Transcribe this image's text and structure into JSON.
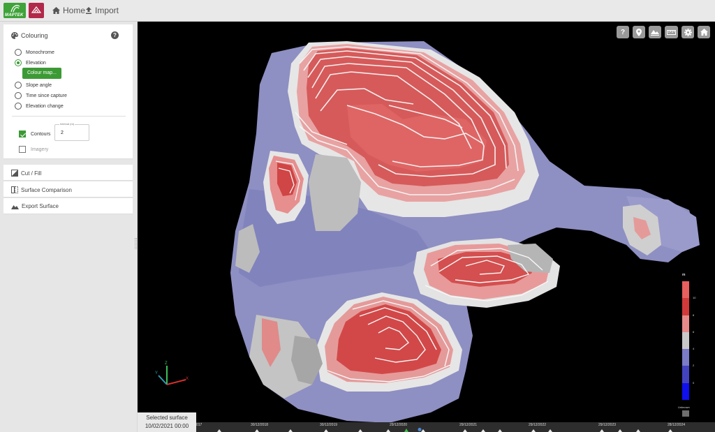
{
  "topbar": {
    "brand_text": "MAPTEK",
    "nav": [
      {
        "label": "Home",
        "icon": "home-icon"
      },
      {
        "label": "Import",
        "icon": "upload-icon"
      }
    ]
  },
  "colouring": {
    "title": "Colouring",
    "help": "?",
    "options": [
      {
        "label": "Monochrome",
        "selected": false
      },
      {
        "label": "Elevation",
        "selected": true
      },
      {
        "label": "Slope angle",
        "selected": false
      },
      {
        "label": "Time since capture",
        "selected": false
      },
      {
        "label": "Elevation change",
        "selected": false
      }
    ],
    "colour_map_button": "Colour map...",
    "contours": {
      "label": "Contours",
      "checked": true,
      "interval_label": "Interval (m)",
      "interval_value": "2"
    },
    "imagery": {
      "label": "Imagery",
      "checked": false
    }
  },
  "panels": {
    "cut_fill": "Cut / Fill",
    "surface_comparison": "Surface Comparison",
    "export_surface": "Export Surface"
  },
  "toolbar": {
    "icons": [
      "help-icon",
      "location-pin-icon",
      "terrain-icon",
      "ruler-icon",
      "settings-icon",
      "home-view-icon"
    ],
    "help_glyph": "?"
  },
  "legend": {
    "unit": "m",
    "ticks": [
      "10",
      "8",
      "6",
      "4",
      "2",
      "0"
    ],
    "unknown_label": "Unknown",
    "colors": [
      "#e85f5f",
      "#d23a3a",
      "#e88a8a",
      "#c9c9c9",
      "#7b7bc8",
      "#4343c0",
      "#1010ee"
    ]
  },
  "axes": {
    "z": "Z",
    "y": "Y",
    "x": "X"
  },
  "selected_surface": {
    "label": "Selected surface",
    "datetime": "10/02/2021 00:00"
  },
  "timeline": {
    "labels": [
      "017",
      "30/12/2018",
      "30/12/2019",
      "29/12/2020",
      "29/12/2021",
      "29/12/2022",
      "29/12/2023",
      "28/12/2024"
    ]
  }
}
